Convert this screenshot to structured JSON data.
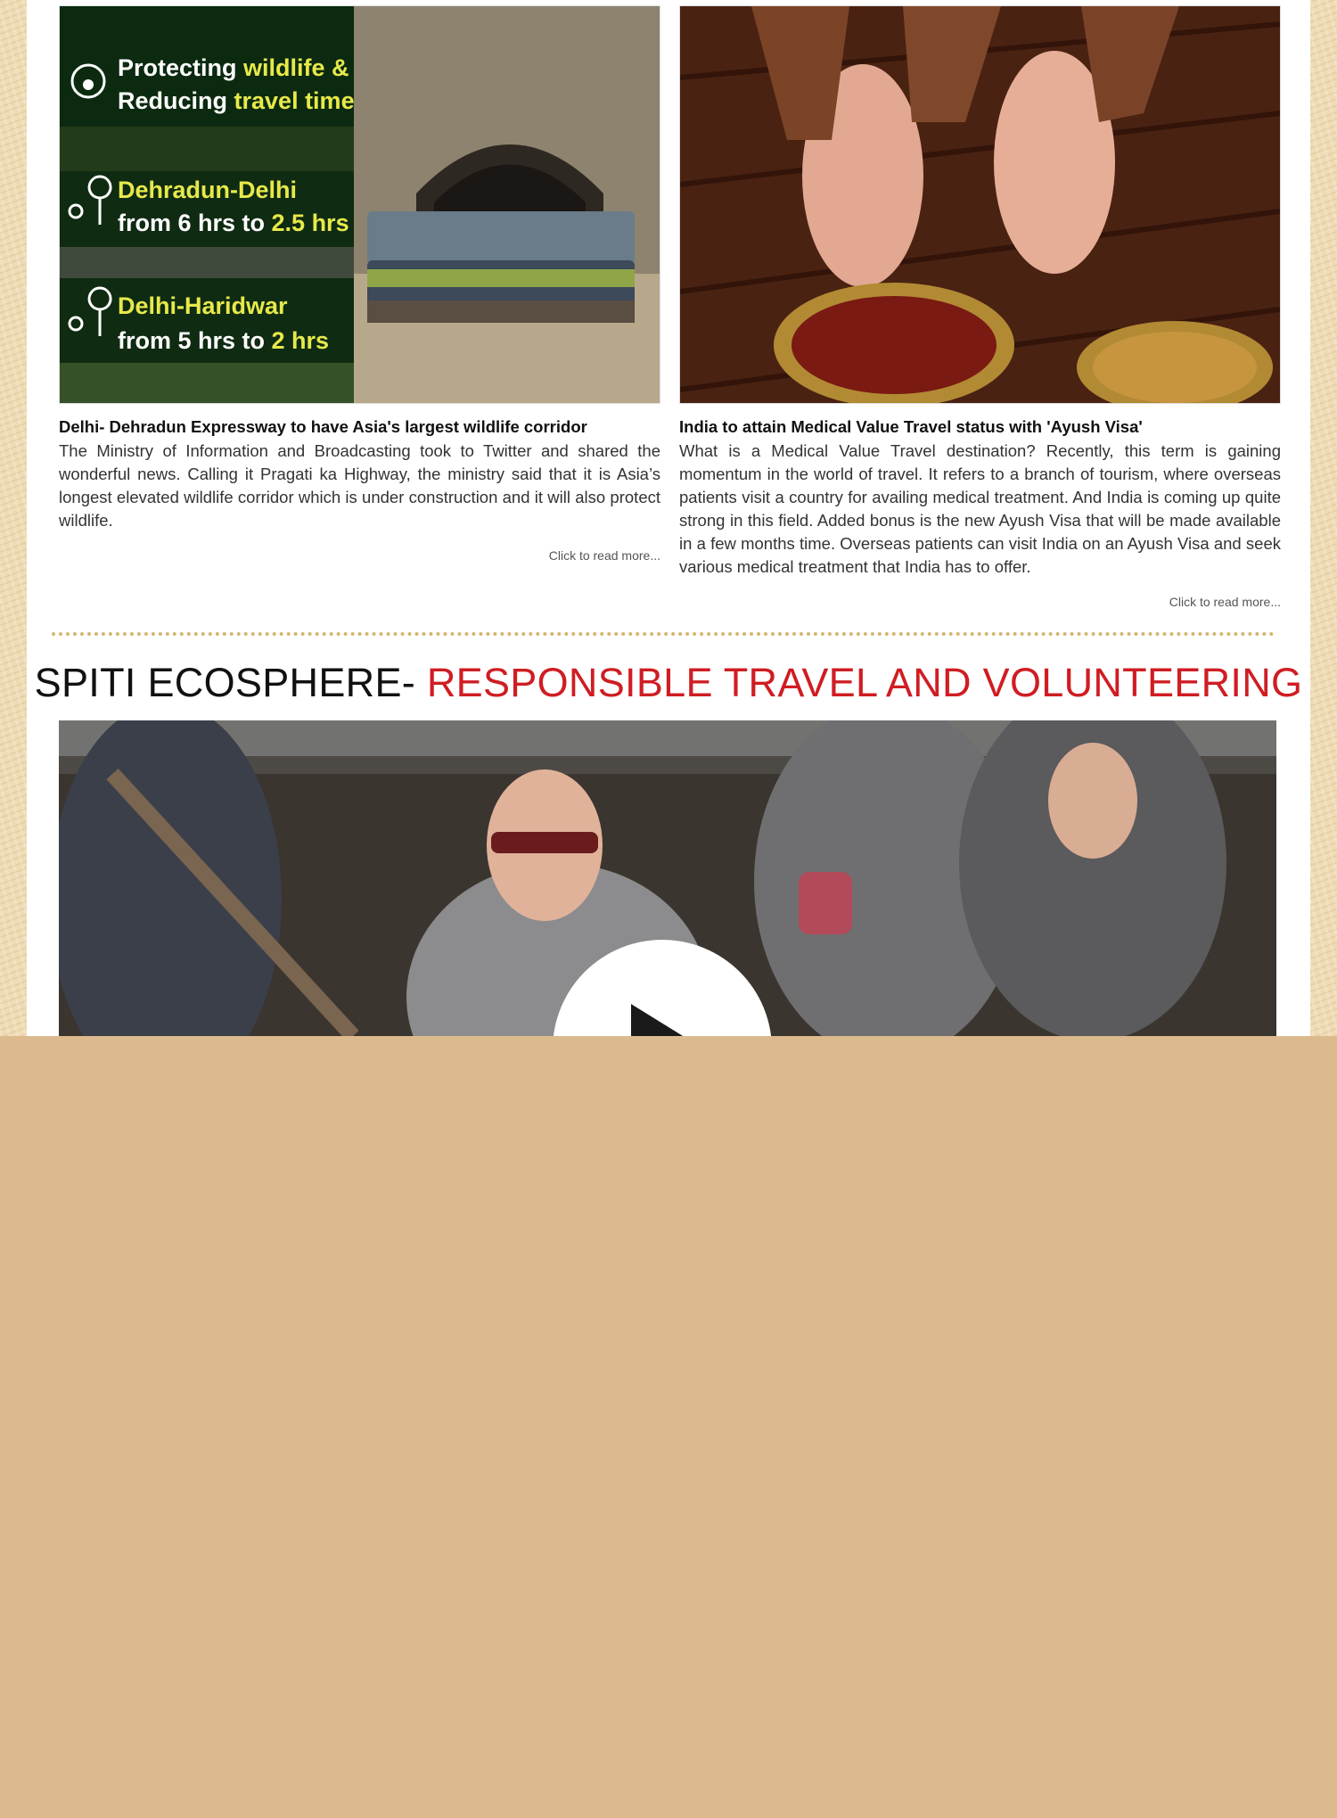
{
  "articles": [
    {
      "image": {
        "name": "Delhi-Dehradun expressway tunnel infographic",
        "lines": [
          {
            "a": "Protecting ",
            "b": "wildlife &"
          },
          {
            "a": "Reducing ",
            "b": "travel time"
          },
          {
            "a": "Dehradun-Delhi",
            "b": ""
          },
          {
            "a": "from 6 hrs to ",
            "b": "2.5 hrs"
          },
          {
            "a": "Delhi-Haridwar",
            "b": ""
          },
          {
            "a": "from 5 hrs to ",
            "b": "2 hrs"
          }
        ]
      },
      "title": "Delhi- Dehradun Expressway to have Asia's largest wildlife corridor",
      "body": "The Ministry of Information and Broadcasting took to Twitter and shared the wonderful news. Calling it Pragati ka Highway, the ministry said that it is Asia’s longest elevated wildlife corridor which is under construction and it will also protect wildlife.",
      "more": "Click to read more..."
    },
    {
      "image": {
        "name": "Ayurvedic foot massage with oil bowls"
      },
      "title": "India to attain Medical Value Travel status with 'Ayush Visa'",
      "body": "What is a Medical Value Travel destination? Recently, this term is gaining momentum in the world of travel. It refers to a branch of tourism, where overseas patients visit a country for availing medical treatment. And India is coming up quite strong in this field. Added bonus is the new Ayush Visa that will be made available in a few months time. Overseas patients can visit India on an Ayush Visa and seek various medical treatment that India has to offer.",
      "more": "Click to read more..."
    }
  ],
  "section": {
    "heading_part1": "SPITI ECOSPHERE- ",
    "heading_part2": "RESPONSIBLE TRAVEL AND VOLUNTEERING",
    "video": {
      "icon": "play-icon"
    }
  },
  "colors": {
    "accent_red": "#cf1d23",
    "page_bg": "#dcba8e",
    "divider": "#d6b56f",
    "infographic_yellow": "#e7e94a"
  }
}
